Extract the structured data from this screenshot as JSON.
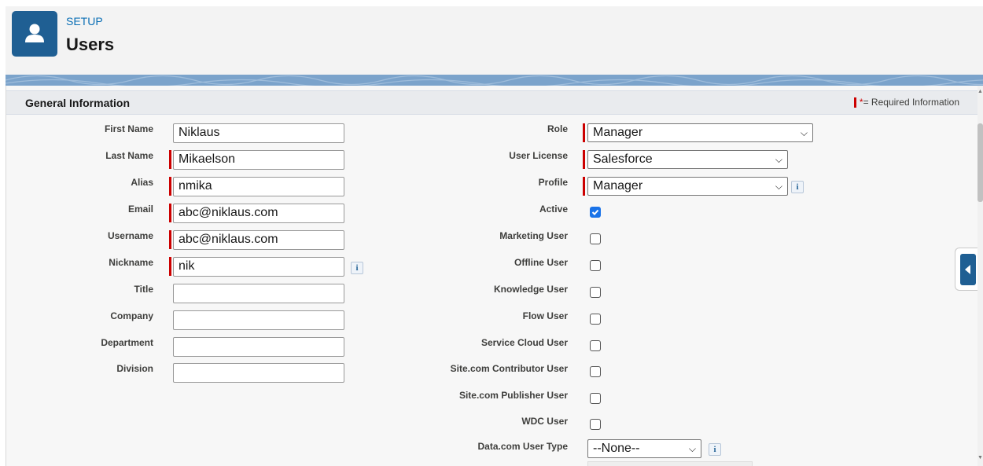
{
  "header": {
    "eyebrow": "SETUP",
    "title": "Users",
    "icon": "user-icon"
  },
  "section": {
    "title": "General Information",
    "required_legend_star": "*",
    "required_legend_text": "= Required Information"
  },
  "left_fields": [
    {
      "label": "First Name",
      "value": "Niklaus",
      "required": false
    },
    {
      "label": "Last Name",
      "value": "Mikaelson",
      "required": true
    },
    {
      "label": "Alias",
      "value": "nmika",
      "required": true
    },
    {
      "label": "Email",
      "value": "abc@niklaus.com",
      "required": true
    },
    {
      "label": "Username",
      "value": "abc@niklaus.com",
      "required": true
    },
    {
      "label": "Nickname",
      "value": "nik",
      "required": true,
      "info": "i"
    },
    {
      "label": "Title",
      "value": "",
      "required": false
    },
    {
      "label": "Company",
      "value": "",
      "required": false
    },
    {
      "label": "Department",
      "value": "",
      "required": false
    },
    {
      "label": "Division",
      "value": "",
      "required": false
    }
  ],
  "right_selects": {
    "role": {
      "label": "Role",
      "value": "Manager"
    },
    "user_license": {
      "label": "User License",
      "value": "Salesforce"
    },
    "profile": {
      "label": "Profile",
      "value": "Manager",
      "info": "i"
    },
    "data_com_user_type": {
      "label": "Data.com User Type",
      "value": "--None--",
      "info": "i"
    }
  },
  "checkboxes": [
    {
      "label": "Active",
      "checked": true
    },
    {
      "label": "Marketing User",
      "checked": false
    },
    {
      "label": "Offline User",
      "checked": false
    },
    {
      "label": "Knowledge User",
      "checked": false
    },
    {
      "label": "Flow User",
      "checked": false
    },
    {
      "label": "Service Cloud User",
      "checked": false
    },
    {
      "label": "Site.com Contributor User",
      "checked": false
    },
    {
      "label": "Site.com Publisher User",
      "checked": false
    },
    {
      "label": "WDC User",
      "checked": false
    }
  ],
  "colors": {
    "brand": "#1f5f93",
    "required": "#cc0000",
    "link": "#0b6fb5",
    "checkbox_checked": "#1a73e8"
  }
}
